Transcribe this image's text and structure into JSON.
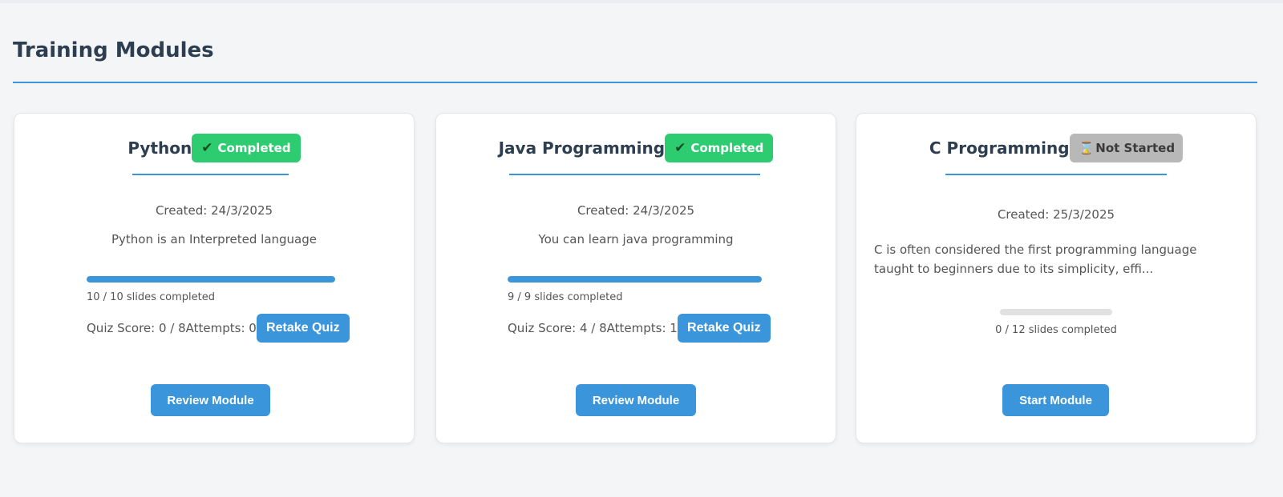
{
  "page": {
    "title": "Training Modules"
  },
  "modules": [
    {
      "title": "Python",
      "status": "Completed",
      "status_icon": "check-icon",
      "created": "Created: 24/3/2025",
      "description": "Python is an Interpreted language",
      "progress": 1.0,
      "slides_text": "10 / 10 slides completed",
      "quiz_text": "Quiz Score: 0 / 8Attempts: 0",
      "retake_label": "Retake Quiz",
      "action_label": "Review Module"
    },
    {
      "title": "Java Programming",
      "status": "Completed",
      "status_icon": "check-icon",
      "created": "Created: 24/3/2025",
      "description": "You can learn java programming",
      "progress": 1.0,
      "slides_text": "9 / 9 slides completed",
      "quiz_text": "Quiz Score: 4 / 8Attempts: 1",
      "retake_label": "Retake Quiz",
      "action_label": "Review Module"
    },
    {
      "title": "C Programming",
      "status": "Not Started",
      "status_icon": "hourglass-icon",
      "created": "Created: 25/3/2025",
      "description": "C is often considered the first programming language taught to beginners due to its simplicity, effi...",
      "progress": 0.0,
      "slides_text": "0 / 12 slides completed",
      "action_label": "Start Module"
    }
  ],
  "colors": {
    "accent": "#3b95db",
    "completed": "#2ecc71",
    "not_started": "#b8b8b8",
    "text_dark": "#2c3e50"
  }
}
